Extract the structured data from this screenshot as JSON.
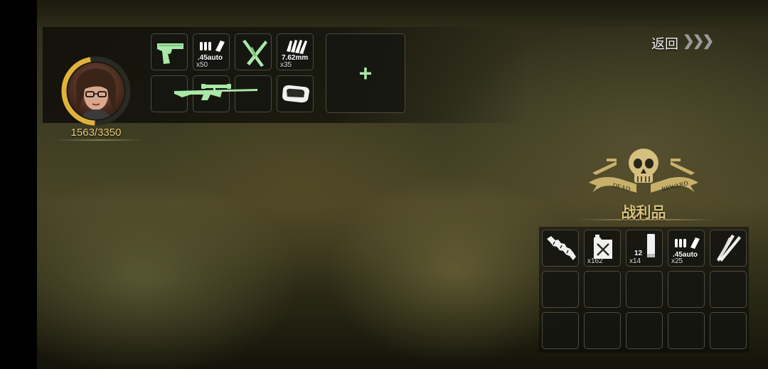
{
  "player": {
    "hp_text": "1563/3350",
    "hp_current": 1563,
    "hp_max": 3350
  },
  "equipment": {
    "slots": [
      {
        "name": "pistol",
        "icon": "pistol-icon"
      },
      {
        "name": "ammo-45",
        "icon": "ammo-icon",
        "caption": ".45auto",
        "qty": "x50"
      },
      {
        "name": "knives",
        "icon": "knives-icon"
      },
      {
        "name": "ammo-762",
        "icon": "ammo-icon",
        "caption": "7.62mm",
        "qty": "x35"
      },
      {
        "name": "sniper-rifle",
        "icon": "sniper-rifle-icon"
      },
      {
        "name": "armor",
        "icon": "armor-icon"
      }
    ],
    "add_symbol": "+"
  },
  "nav": {
    "back_label": "返回",
    "back_arrows": "❯❯❯"
  },
  "loot": {
    "title": "战利品",
    "emblem_left": "DEAD",
    "emblem_right": "REWARD",
    "items": [
      {
        "name": "branch",
        "icon": "branch-icon"
      },
      {
        "name": "jerry-can",
        "icon": "jerry-can-icon",
        "qty": "x162"
      },
      {
        "name": "shotgun-shells",
        "icon": "shell-icon",
        "caption": "12",
        "qty": "x14"
      },
      {
        "name": "ammo-45",
        "icon": "ammo-icon",
        "caption": ".45auto",
        "qty": "x25"
      },
      {
        "name": "knives",
        "icon": "knives-icon"
      }
    ]
  },
  "colors": {
    "item_green": "#a8e8a8",
    "item_white": "#f0f0f0",
    "hp_gold": "#e8c97a",
    "loot_gold": "#d8c07a"
  }
}
